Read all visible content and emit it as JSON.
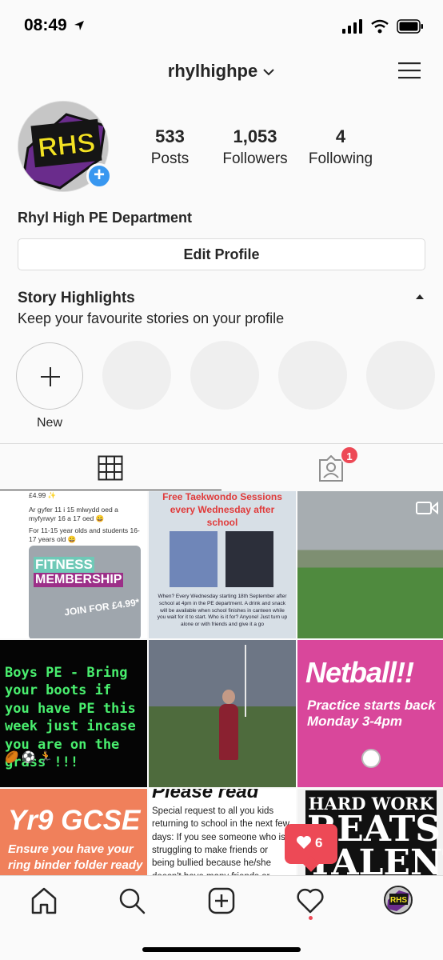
{
  "status_bar": {
    "time": "08:49"
  },
  "header": {
    "username": "rhylhighpe"
  },
  "profile": {
    "avatar_text": "RHS",
    "display_name": "Rhyl High PE Department",
    "edit_profile_label": "Edit Profile"
  },
  "stats": [
    {
      "value": "533",
      "label": "Posts"
    },
    {
      "value": "1,053",
      "label": "Followers"
    },
    {
      "value": "4",
      "label": "Following"
    }
  ],
  "highlights": {
    "title": "Story Highlights",
    "subtitle": "Keep your favourite stories on your profile",
    "new_label": "New"
  },
  "tabs": {
    "tagged_badge": "1"
  },
  "posts": {
    "p1": {
      "price_top": "£4.99 ✨",
      "welsh": "Ar gyfer 11 i 15 mlwydd oed a myfyrwyr 16 a 17 oed 😀",
      "english": "For 11-15 year olds and students 16-17 years old 😀",
      "fitness": "FITNESS",
      "membership": "MEMBERSHIP",
      "join": "JOIN FOR £4.99*"
    },
    "p2": {
      "heading1": "Free Taekwondo Sessions",
      "heading2": "every Wednesday after",
      "heading3": "school",
      "body": "When? Every Wednesday starting 18th September after school at 4pm in the PE department. A drink and snack will be available when school finishes in canteen while you wait for it to start. Who is it for? Anyone! Just turn up alone or with friends and give it a go"
    },
    "p4": {
      "text": "Boys PE - Bring your boots if you have PE this week just incase you are on the grass !!!",
      "emoji": "🏉 ⚽ 🏃"
    },
    "p6": {
      "big": "Netball!!",
      "sub": "Practice starts back Monday 3-4pm"
    },
    "p7": {
      "big": "Yr9 GCSE",
      "sub": "Ensure you have your ring binder folder ready for"
    },
    "p8": {
      "title": "Please read",
      "body": "Special request to all you kids returning to school in the next few days: If you see someone who is struggling to make friends or being bullied because he/she doesn't have many friends or because they are shy or not as pretty or not dressed in the"
    },
    "p9": {
      "line1": "HARD WORK",
      "line2": "BEATS",
      "line3": "TALENT"
    }
  },
  "activity_notification": {
    "count": "6"
  },
  "colors": {
    "accent": "#3897f0",
    "notification": "#ed4956"
  }
}
